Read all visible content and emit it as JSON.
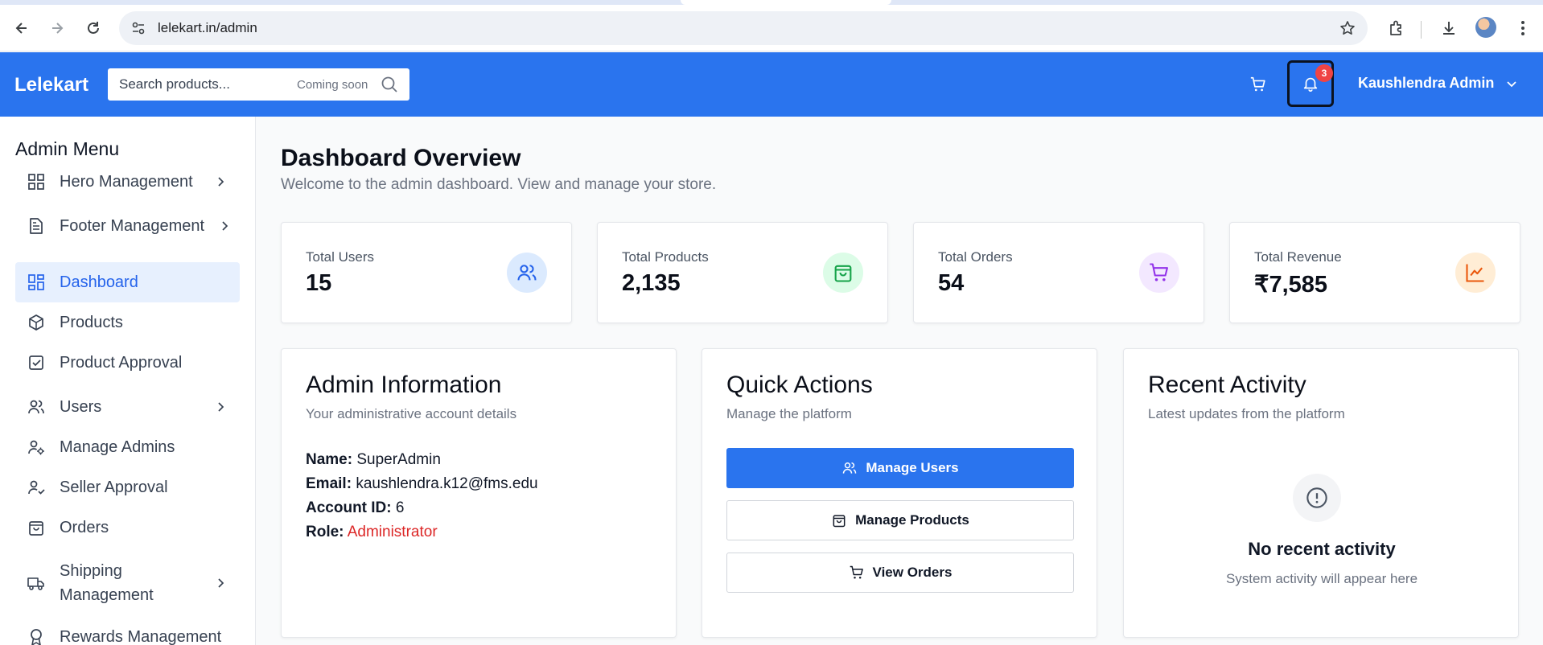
{
  "browser": {
    "url": "lelekart.in/admin"
  },
  "header": {
    "brand": "Lelekart",
    "search_placeholder": "Search products...",
    "search_hint": "Coming soon",
    "notification_count": "3",
    "user_name": "Kaushlendra Admin",
    "accent_color": "#2a74ee"
  },
  "sidebar": {
    "title": "Admin Menu",
    "items": [
      {
        "label": "Hero Management",
        "icon": "grid-icon",
        "has_submenu": true
      },
      {
        "label": "Footer Management",
        "icon": "document-icon",
        "has_submenu": true
      },
      {
        "label": "Dashboard",
        "icon": "dashboard-icon",
        "active": true
      },
      {
        "label": "Products",
        "icon": "box-icon"
      },
      {
        "label": "Product Approval",
        "icon": "check-square-icon"
      },
      {
        "label": "Users",
        "icon": "users-icon",
        "has_submenu": true
      },
      {
        "label": "Manage Admins",
        "icon": "user-gear-icon"
      },
      {
        "label": "Seller Approval",
        "icon": "user-check-icon"
      },
      {
        "label": "Orders",
        "icon": "bag-icon"
      },
      {
        "label": "Shipping Management",
        "icon": "truck-icon",
        "has_submenu": true
      },
      {
        "label": "Rewards Management",
        "icon": "award-icon"
      }
    ]
  },
  "main": {
    "title": "Dashboard Overview",
    "subtitle": "Welcome to the admin dashboard. View and manage your store.",
    "stats": [
      {
        "label": "Total Users",
        "value": "15",
        "icon": "users-icon",
        "color": "#2563eb"
      },
      {
        "label": "Total Products",
        "value": "2,135",
        "icon": "shopping-bag-icon",
        "color": "#16a34a"
      },
      {
        "label": "Total Orders",
        "value": "54",
        "icon": "cart-icon",
        "color": "#9333ea"
      },
      {
        "label": "Total Revenue",
        "value": "₹7,585",
        "icon": "trend-icon",
        "color": "#ea580c"
      }
    ],
    "admin_info": {
      "title": "Admin Information",
      "subtitle": "Your administrative account details",
      "name_label": "Name:",
      "name": "SuperAdmin",
      "email_label": "Email:",
      "email": "kaushlendra.k12@fms.edu",
      "account_label": "Account ID:",
      "account_id": "6",
      "role_label": "Role:",
      "role": "Administrator"
    },
    "quick_actions": {
      "title": "Quick Actions",
      "subtitle": "Manage the platform",
      "buttons": [
        "Manage Users",
        "Manage Products",
        "View Orders"
      ]
    },
    "recent_activity": {
      "title": "Recent Activity",
      "subtitle": "Latest updates from the platform",
      "empty_title": "No recent activity",
      "empty_sub": "System activity will appear here"
    }
  }
}
